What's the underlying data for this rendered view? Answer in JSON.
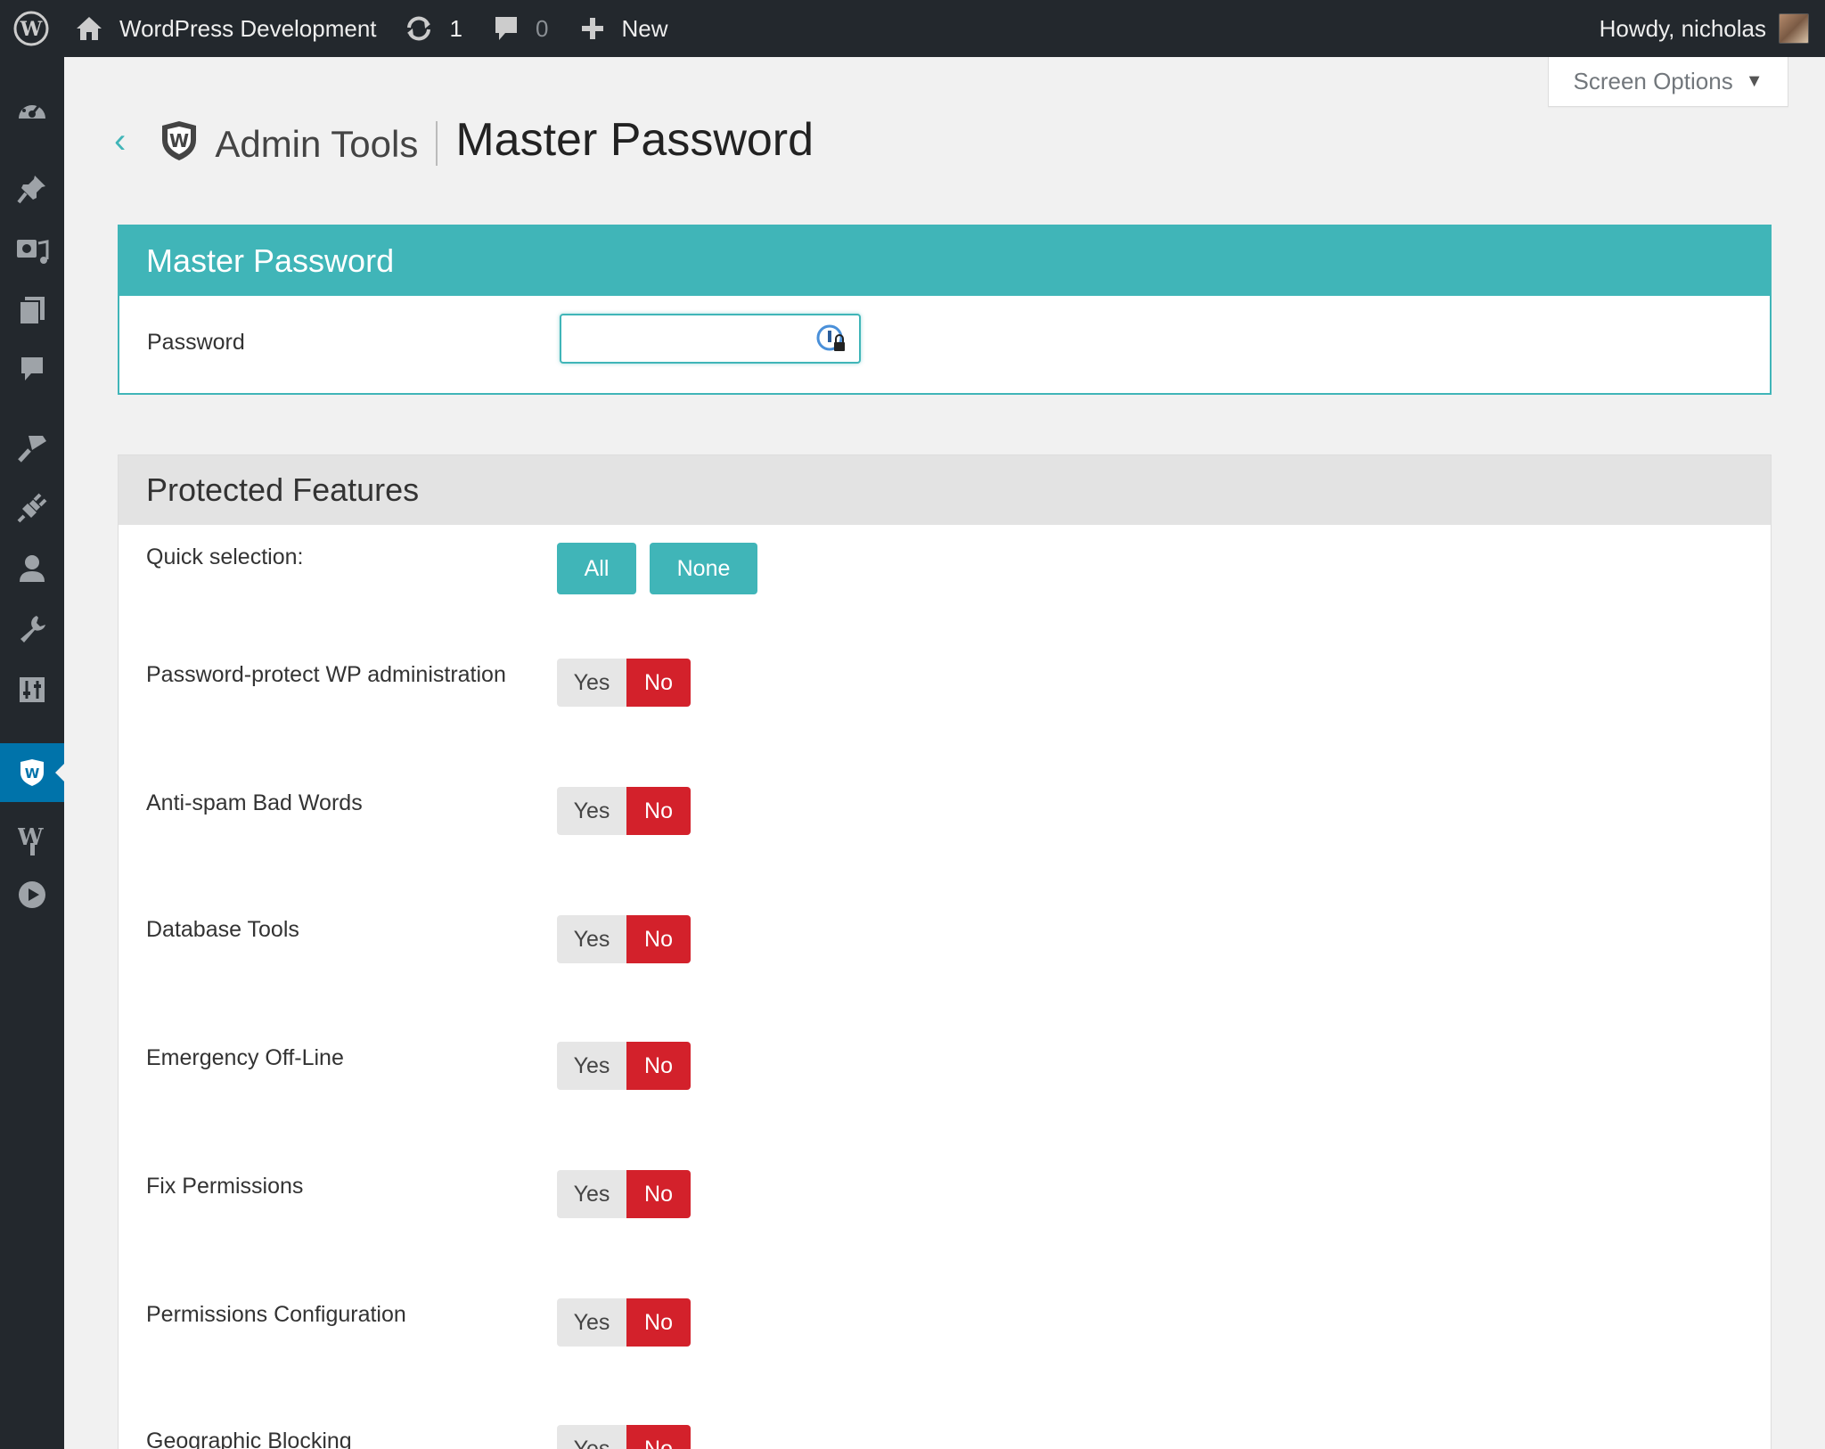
{
  "adminbar": {
    "site_name": "WordPress Development",
    "updates_count": "1",
    "comments_count": "0",
    "new_label": "New",
    "howdy": "Howdy, nicholas"
  },
  "sidebar": {
    "items": [
      "dashboard",
      "posts",
      "media",
      "pages",
      "comments",
      "appearance",
      "plugins",
      "users",
      "tools",
      "settings",
      "admin-tools",
      "wp-plugin",
      "video"
    ],
    "current": "admin-tools"
  },
  "screen_options": {
    "label": "Screen Options",
    "arrow": "▼"
  },
  "header": {
    "back": "‹",
    "brand": "Admin Tools",
    "title": "Master Password"
  },
  "master_password": {
    "heading": "Master Password",
    "password_label": "Password",
    "password_value": ""
  },
  "protected_features": {
    "heading": "Protected Features",
    "quick_selection_label": "Quick selection:",
    "all_label": "All",
    "none_label": "None",
    "yes_label": "Yes",
    "no_label": "No",
    "features": [
      {
        "label": "Password-protect WP administration",
        "value": "No"
      },
      {
        "label": "Anti-spam Bad Words",
        "value": "No"
      },
      {
        "label": "Database Tools",
        "value": "No"
      },
      {
        "label": "Emergency Off-Line",
        "value": "No"
      },
      {
        "label": "Fix Permissions",
        "value": "No"
      },
      {
        "label": "Permissions Configuration",
        "value": "No"
      },
      {
        "label": "Geographic Blocking",
        "value": "No"
      }
    ]
  },
  "colors": {
    "accent": "#40b5b8",
    "no_active": "#d3212b",
    "adminbar_bg": "#23282d",
    "current_menu": "#0073aa"
  }
}
